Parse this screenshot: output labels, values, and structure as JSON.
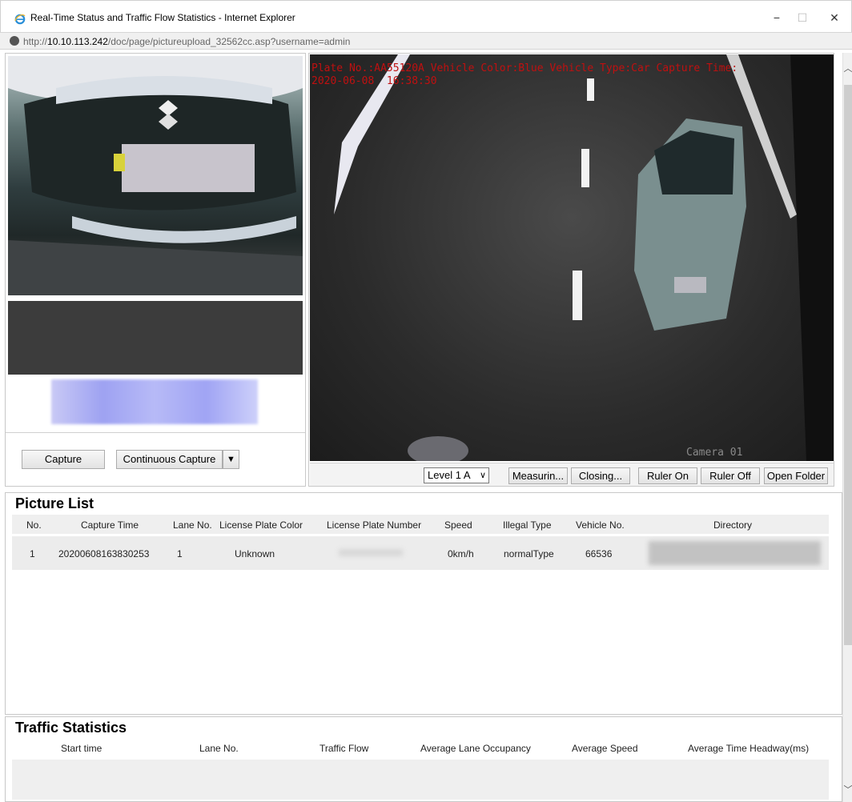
{
  "window": {
    "title": "Real-Time Status and Traffic Flow Statistics - Internet Explorer",
    "url_prefix": "http://",
    "url_host": "10.10.113.242",
    "url_path": "/doc/page/pictureupload_32562cc.asp?username=admin",
    "minimize_glyph": "−",
    "maximize_glyph": "☐",
    "close_glyph": "✕"
  },
  "capture_panel": {
    "capture_label": "Capture",
    "continuous_label": "Continuous Capture",
    "dropdown_glyph": "▼"
  },
  "scene": {
    "osd_line1": "Plate No.:AA55120A Vehicle Color:Blue Vehicle Type:Car Capture Time:",
    "osd_line2": "2020-06-08  16:38:30",
    "camera_label": "Camera 01"
  },
  "toolbar": {
    "level_value": "Level 1 A",
    "level_arrow": "∨",
    "measure_label": "Measurin...",
    "closing_label": "Closing...",
    "ruler_on_label": "Ruler On",
    "ruler_off_label": "Ruler Off",
    "open_folder_label": "Open Folder"
  },
  "picture_list": {
    "title": "Picture List",
    "columns": [
      "No.",
      "Capture Time",
      "Lane No.",
      "License Plate Color",
      "License Plate Number",
      "Speed",
      "Illegal Type",
      "Vehicle No.",
      "Directory"
    ],
    "rows": [
      {
        "no": "1",
        "capture_time": "20200608163830253",
        "lane_no": "1",
        "plate_color": "Unknown",
        "speed": "0km/h",
        "illegal_type": "normalType",
        "vehicle_no": "66536"
      }
    ]
  },
  "traffic_statistics": {
    "title": "Traffic Statistics",
    "columns": [
      "Start time",
      "Lane No.",
      "Traffic Flow",
      "Average Lane Occupancy",
      "Average Speed",
      "Average Time Headway(ms)"
    ]
  },
  "scrollbar": {
    "up_glyph": "︿",
    "down_glyph": "﹀"
  },
  "icons": {
    "browser_icon": "ie-icon",
    "site_icon": "site-icon"
  }
}
